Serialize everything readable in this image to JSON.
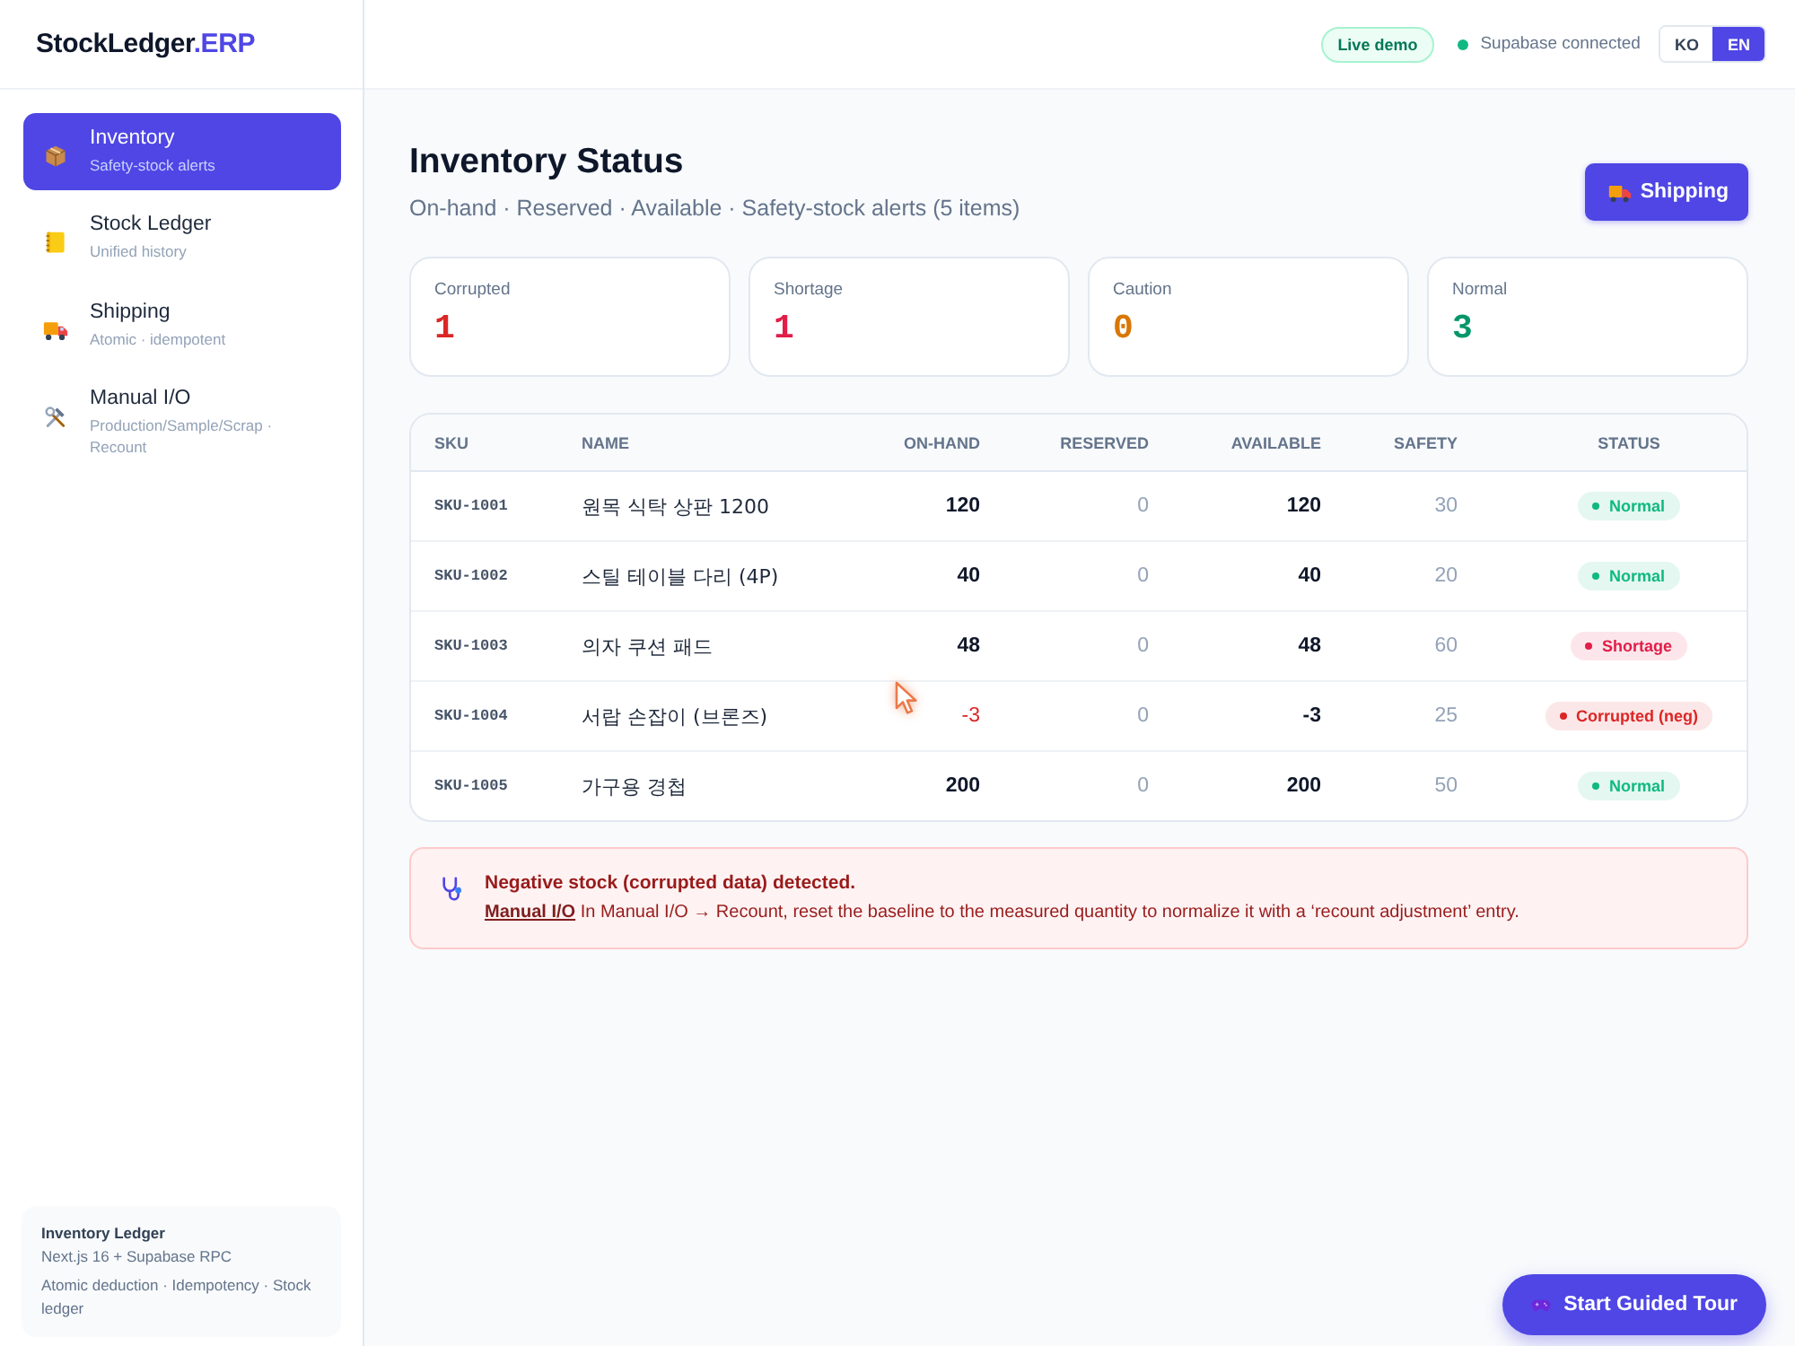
{
  "sidebar": {
    "logo": {
      "name": "StockLedger",
      "suffix": ".ERP"
    },
    "items": [
      {
        "title": "Inventory",
        "subtitle": "Safety-stock alerts",
        "selected": true
      },
      {
        "title": "Stock Ledger",
        "subtitle": "Unified history",
        "selected": false
      },
      {
        "title": "Shipping",
        "subtitle": "Atomic · idempotent",
        "selected": false
      },
      {
        "title": "Manual I/O",
        "subtitle": "Production/Sample/Scrap · Recount",
        "selected": false
      }
    ],
    "info_card": {
      "title": "Inventory Ledger",
      "lines": [
        "Next.js 16 + Supabase RPC",
        "Atomic deduction · Idempotency · Stock ledger"
      ]
    }
  },
  "header": {
    "badge": "Live demo",
    "connection": {
      "label": "Supabase connected",
      "connected": true
    },
    "languages": [
      {
        "label": "KO",
        "selected": false
      },
      {
        "label": "EN",
        "selected": true
      }
    ]
  },
  "page": {
    "title": "Inventory Status",
    "subtitle": "On-hand · Reserved · Available · Safety-stock alerts (5 items)",
    "action_button": "Shipping"
  },
  "stats": [
    {
      "label": "Corrupted",
      "value": "1",
      "color": "#dc2626"
    },
    {
      "label": "Shortage",
      "value": "1",
      "color": "#e11d48"
    },
    {
      "label": "Caution",
      "value": "0",
      "color": "#d97706"
    },
    {
      "label": "Normal",
      "value": "3",
      "color": "#059669"
    }
  ],
  "table": {
    "columns": [
      "SKU",
      "NAME",
      "ON-HAND",
      "RESERVED",
      "AVAILABLE",
      "SAFETY",
      "STATUS"
    ],
    "rows": [
      {
        "sku": "SKU-1001",
        "name": "원목 식탁 상판 1200",
        "on_hand": "120",
        "on_hand_negative": false,
        "reserved": "0",
        "available": "120",
        "safety": "30",
        "status": {
          "label": "Normal",
          "color": "#10b981"
        }
      },
      {
        "sku": "SKU-1002",
        "name": "스틸 테이블 다리 (4P)",
        "on_hand": "40",
        "on_hand_negative": false,
        "reserved": "0",
        "available": "40",
        "safety": "20",
        "status": {
          "label": "Normal",
          "color": "#10b981"
        }
      },
      {
        "sku": "SKU-1003",
        "name": "의자 쿠션 패드",
        "on_hand": "48",
        "on_hand_negative": false,
        "reserved": "0",
        "available": "48",
        "safety": "60",
        "status": {
          "label": "Shortage",
          "color": "#e11d48"
        }
      },
      {
        "sku": "SKU-1004",
        "name": "서랍 손잡이 (브론즈)",
        "on_hand": "-3",
        "on_hand_negative": true,
        "reserved": "0",
        "available": "-3",
        "safety": "25",
        "status": {
          "label": "Corrupted (neg)",
          "color": "#dc2626"
        }
      },
      {
        "sku": "SKU-1005",
        "name": "가구용 경첩",
        "on_hand": "200",
        "on_hand_negative": false,
        "reserved": "0",
        "available": "200",
        "safety": "50",
        "status": {
          "label": "Normal",
          "color": "#10b981"
        }
      }
    ]
  },
  "alert": {
    "title": "Negative stock (corrupted data) detected.",
    "link": "Manual I/O",
    "message": "In Manual I/O → Recount, reset the baseline to the measured quantity to normalize it with a ‘recount adjustment’ entry."
  },
  "tour_button": "Start Guided Tour"
}
